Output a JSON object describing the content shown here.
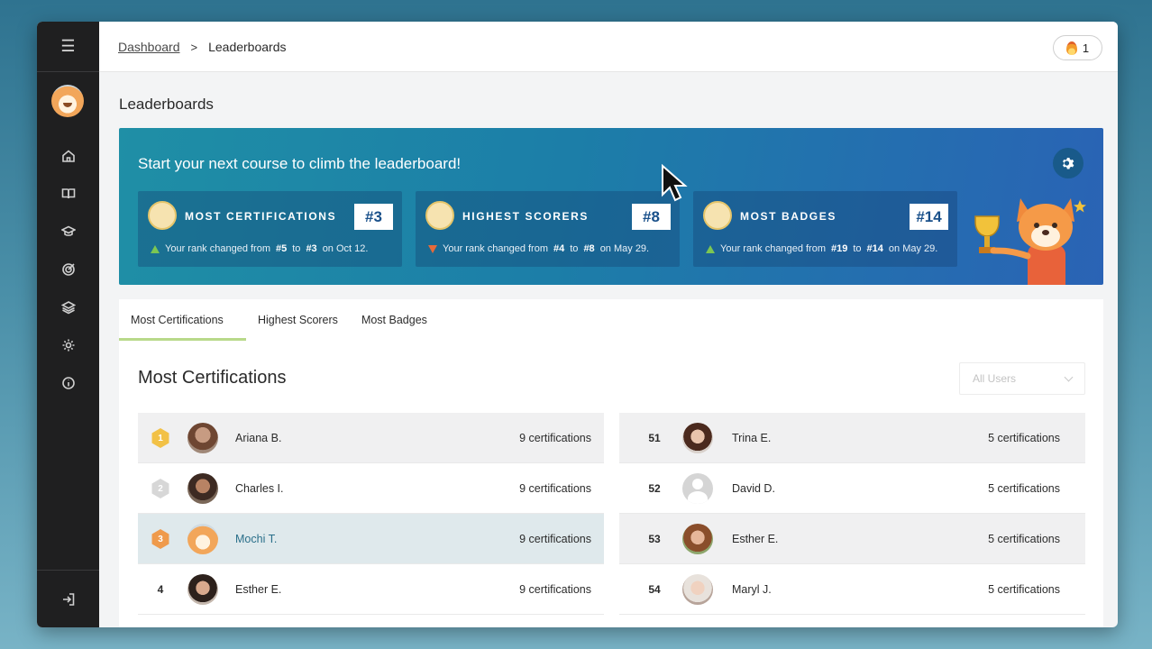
{
  "breadcrumb": {
    "root": "Dashboard",
    "separator": ">",
    "current": "Leaderboards"
  },
  "streak": {
    "icon": "flame-icon",
    "count": "1"
  },
  "page_title": "Leaderboards",
  "banner": {
    "title": "Start your next course to climb the leaderboard!",
    "cards": [
      {
        "name": "MOST CERTIFICATIONS",
        "rank": "#3",
        "direction": "up",
        "note_prefix": "Your rank changed from",
        "from": "#5",
        "to_word": "to",
        "to": "#3",
        "date": "on Oct 12."
      },
      {
        "name": "HIGHEST SCORERS",
        "rank": "#8",
        "direction": "down",
        "note_prefix": "Your rank changed from",
        "from": "#4",
        "to_word": "to",
        "to": "#8",
        "date": "on May 29."
      },
      {
        "name": "MOST BADGES",
        "rank": "#14",
        "direction": "up",
        "note_prefix": "Your rank changed from",
        "from": "#19",
        "to_word": "to",
        "to": "#14",
        "date": "on May 29."
      }
    ]
  },
  "tabs": [
    "Most Certifications",
    "Highest Scorers",
    "Most Badges"
  ],
  "section_title": "Most Certifications",
  "filter": {
    "value": "All Users"
  },
  "left_rows": [
    {
      "rank": "1",
      "medal": "gold",
      "name": "Ariana B.",
      "certs": "9 certifications"
    },
    {
      "rank": "2",
      "medal": "silver",
      "name": "Charles I.",
      "certs": "9 certifications"
    },
    {
      "rank": "3",
      "medal": "bronze",
      "name": "Mochi T.",
      "certs": "9 certifications"
    },
    {
      "rank": "4",
      "medal": "",
      "name": "Esther E.",
      "certs": "9 certifications"
    }
  ],
  "right_rows": [
    {
      "rank": "51",
      "name": "Trina E.",
      "certs": "5 certifications"
    },
    {
      "rank": "52",
      "name": "David D.",
      "certs": "5 certifications"
    },
    {
      "rank": "53",
      "name": "Esther E.",
      "certs": "5 certifications"
    },
    {
      "rank": "54",
      "name": "Maryl J.",
      "certs": "5 certifications"
    }
  ]
}
